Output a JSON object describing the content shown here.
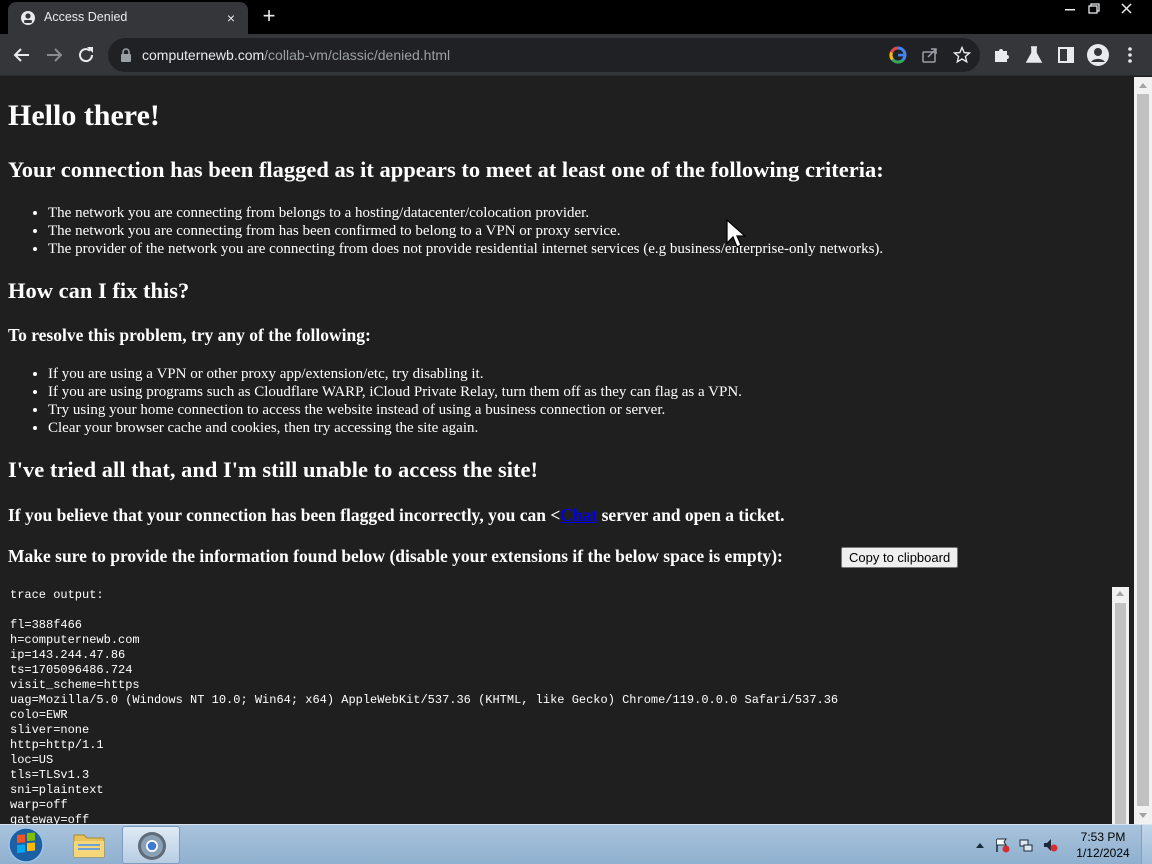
{
  "browser": {
    "tab_title": "Access Denied",
    "tab_close": "×",
    "new_tab": "+",
    "url_host": "computernewb.com",
    "url_path": "/collab-vm/classic/denied.html"
  },
  "page": {
    "hello": "Hello there!",
    "flagged_heading": "Your connection has been flagged as it appears to meet at least one of the following criteria:",
    "criteria": [
      "The network you are connecting from belongs to a hosting/datacenter/colocation provider.",
      "The network you are connecting from has been confirmed to belong to a VPN or proxy service.",
      "The provider of the network you are connecting from does not provide residential internet services (e.g business/enterprise-only networks)."
    ],
    "fix_heading": "How can I fix this?",
    "resolve_heading": "To resolve this problem, try any of the following:",
    "fixes": [
      "If you are using a VPN or other proxy app/extension/etc, try disabling it.",
      "If you are using programs such as Cloudflare WARP, iCloud Private Relay, turn them off as they can flag as a VPN.",
      "Try using your home connection to access the website instead of using a business connection or server.",
      "Clear your browser cache and cookies, then try accessing the site again."
    ],
    "tried_heading": "I've tried all that, and I'm still unable to access the site!",
    "incorrect_prefix": "If you believe that your connection has been flagged incorrectly, you can <",
    "incorrect_link": "Chat",
    "incorrect_suffix": " server and open a ticket.",
    "provide_info": "Make sure to provide the information found below (disable your extensions if the below space is empty):",
    "copy_button": "Copy to clipboard",
    "trace_lines": [
      "trace output:",
      "",
      "fl=388f466",
      "h=computernewb.com",
      "ip=143.244.47.86",
      "ts=1705096486.724",
      "visit_scheme=https",
      "uag=Mozilla/5.0 (Windows NT 10.0; Win64; x64) AppleWebKit/537.36 (KHTML, like Gecko) Chrome/119.0.0.0 Safari/537.36",
      "colo=EWR",
      "sliver=none",
      "http=http/1.1",
      "loc=US",
      "tls=TLSv1.3",
      "sni=plaintext",
      "warp=off",
      "gateway=off"
    ]
  },
  "taskbar": {
    "time": "7:53 PM",
    "date": "1/12/2024"
  },
  "colors": {
    "page_bg": "#1f1f1f",
    "link": "#0000ee",
    "chrome_toolbar": "#35363a"
  }
}
